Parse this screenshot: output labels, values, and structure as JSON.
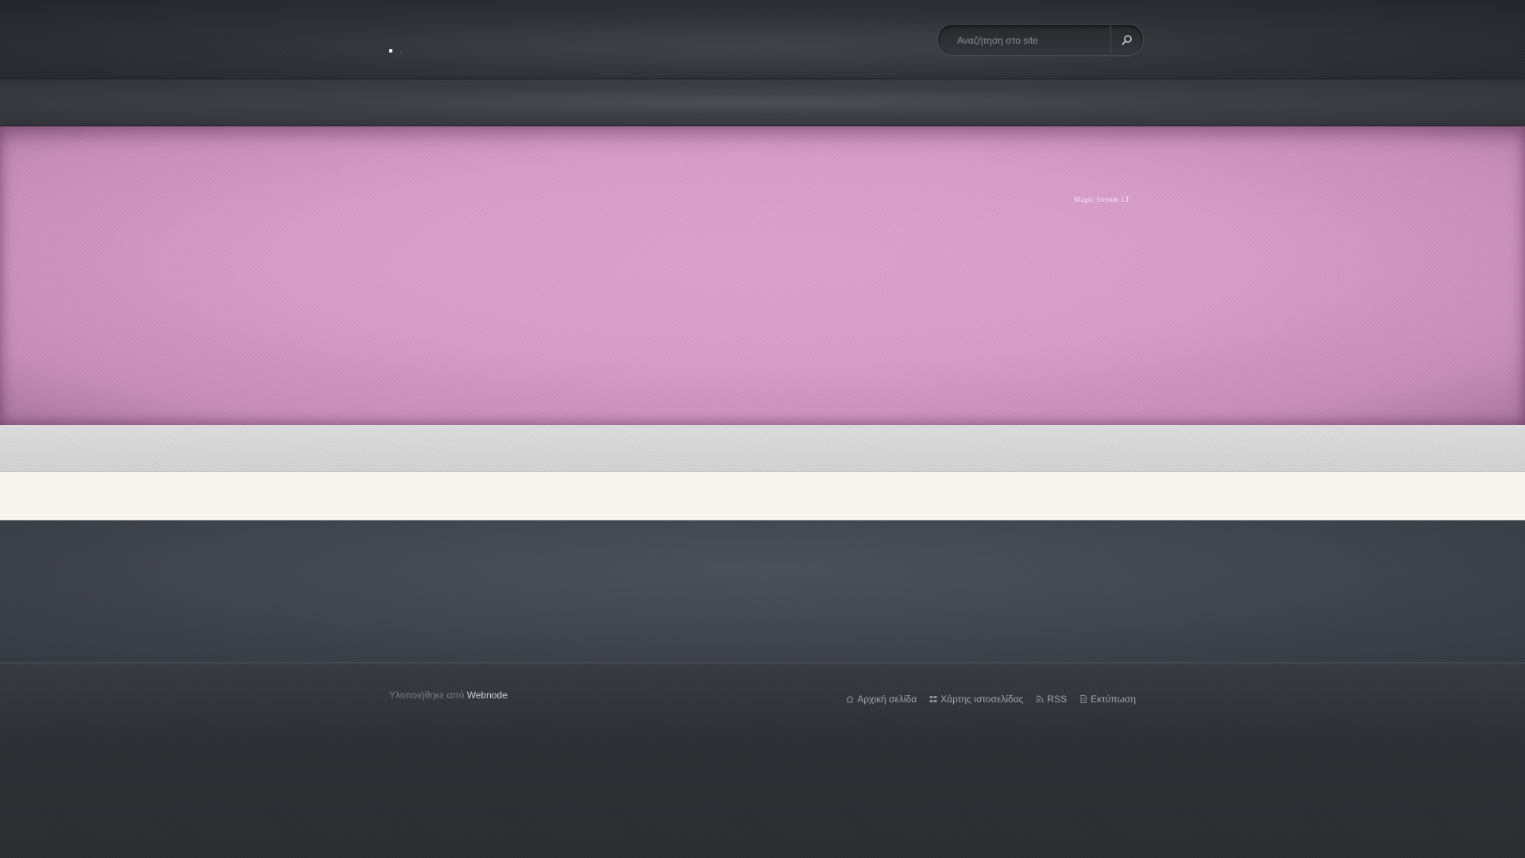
{
  "header": {
    "logo_text": "■ ,",
    "search": {
      "placeholder": "Αναζήτηση στο site",
      "button_icon": "search-icon"
    }
  },
  "banner": {
    "label": "Magic Stream LT"
  },
  "footer": {
    "credit_prefix": "Υλοποιήθηκε από",
    "credit_link": "Webnode",
    "links": [
      {
        "label": "Αρχική σελίδα",
        "icon": "home-icon"
      },
      {
        "label": "Χάρτης ιστοσελίδας",
        "icon": "sitemap-icon"
      },
      {
        "label": "RSS",
        "icon": "rss-icon"
      },
      {
        "label": "Εκτύπωση",
        "icon": "print-icon"
      }
    ]
  },
  "colors": {
    "header_bg": "#2c2e33",
    "banner_pink": "#d59cc7",
    "content_cream": "#f6f5ef",
    "footer_bg": "#2e2f34"
  }
}
